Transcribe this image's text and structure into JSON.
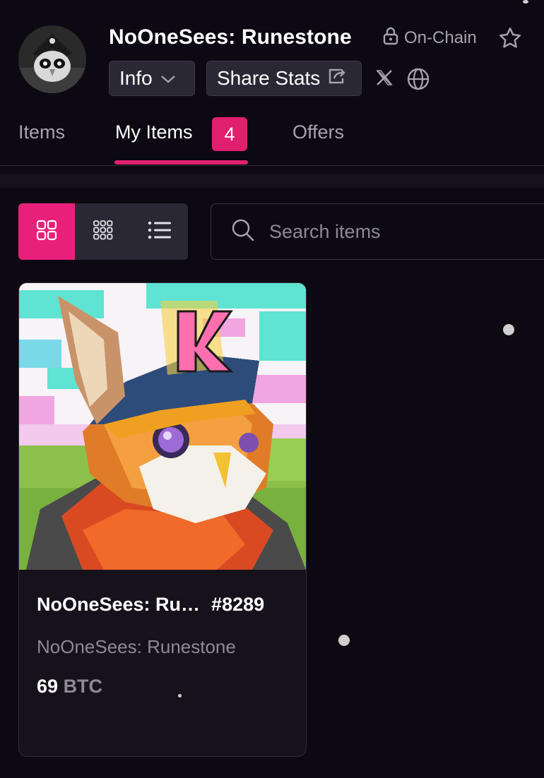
{
  "collection": {
    "title": "NoOneSees: Runestone",
    "chain_label": "On-Chain"
  },
  "header": {
    "info_label": "Info",
    "share_label": "Share Stats"
  },
  "tabs": [
    {
      "label": "Items"
    },
    {
      "label": "My Items",
      "badge": "4"
    },
    {
      "label": "Offers"
    }
  ],
  "search": {
    "placeholder": "Search items"
  },
  "items": [
    {
      "name": "NoOneSees: Ru…",
      "number": "#8289",
      "collection": "NoOneSees: Runestone",
      "price": "69",
      "currency": "BTC"
    }
  ],
  "icons": {
    "lock": "lock-icon",
    "star": "star-icon",
    "chevron": "chevron-down-icon",
    "share": "share-icon",
    "x": "x-logo-icon",
    "globe": "globe-icon",
    "grid_large": "grid-large-icon",
    "grid_small": "grid-small-icon",
    "list": "list-icon",
    "search": "search-icon"
  },
  "colors": {
    "accent": "#e0206f",
    "background": "#0c0912"
  }
}
